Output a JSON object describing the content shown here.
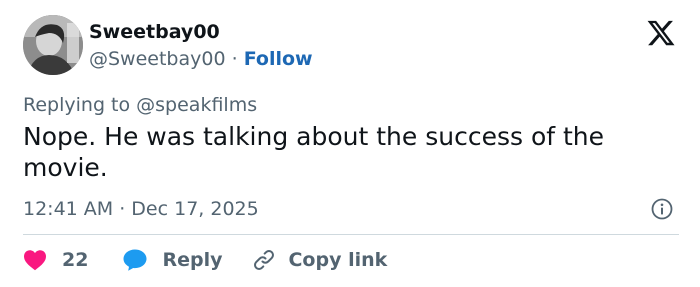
{
  "author": {
    "display_name": "Sweetbay00",
    "handle": "@Sweetbay00",
    "separator": "·",
    "follow_label": "Follow"
  },
  "reply_context": "Replying to @speakfilms",
  "tweet": {
    "text": "Nope. He was talking about the success of the movie.",
    "timestamp": "12:41 AM · Dec 17, 2025"
  },
  "actions": {
    "like_count": "22",
    "reply_label": "Reply",
    "copy_link_label": "Copy link"
  },
  "icons": {
    "brand": "x-logo-icon",
    "info": "info-icon",
    "like": "heart-icon",
    "reply": "speech-bubble-icon",
    "copy": "link-icon"
  },
  "colors": {
    "text": "#0f1419",
    "secondary": "#536471",
    "follow": "#1d68b4",
    "heart": "#f91880",
    "reply_icon": "#1d9bf0",
    "divider": "#cfd9de"
  }
}
